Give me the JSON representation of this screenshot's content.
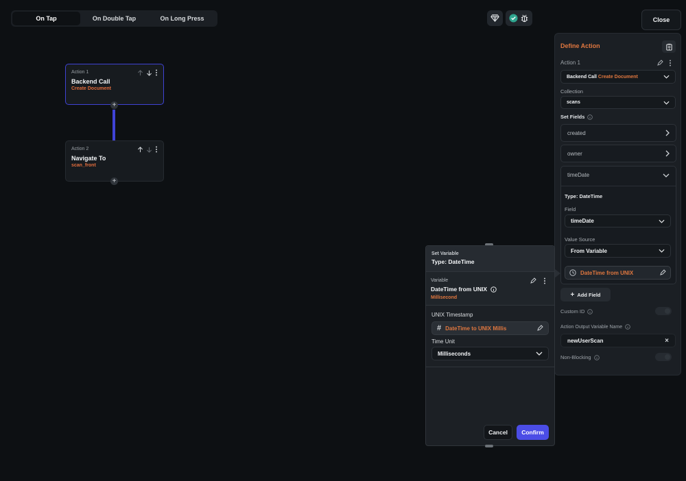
{
  "trigger_tabs": [
    "On Tap",
    "On Double Tap",
    "On Long Press"
  ],
  "header": {
    "close_label": "Close"
  },
  "actions": [
    {
      "num": "Action 1",
      "title": "Backend Call",
      "sub": "Create Document"
    },
    {
      "num": "Action 2",
      "title": "Navigate To",
      "sub": "scan_front"
    }
  ],
  "define_action": {
    "title": "Define Action",
    "action_label": "Action 1",
    "action_type": "Backend Call",
    "action_subtype": "Create Document",
    "collection_label": "Collection",
    "collection_value": "scans",
    "set_fields_label": "Set Fields",
    "fields": [
      "created",
      "owner",
      "timeDate"
    ],
    "type_label": "Type: DateTime",
    "field_label": "Field",
    "field_value": "timeDate",
    "value_source_label": "Value Source",
    "value_source": "From Variable",
    "variable_chip": "DateTime from UNIX",
    "add_field": "Add Field",
    "custom_id_label": "Custom ID",
    "output_var_label": "Action Output Variable Name",
    "output_var_value": "newUserScan",
    "non_blocking_label": "Non-Blocking"
  },
  "set_variable": {
    "header_small": "Set Variable",
    "header_type": "Type: DateTime",
    "variable_label": "Variable",
    "variable_name": "DateTime from UNIX",
    "variable_sub": "Millisecond",
    "unix_label": "UNIX Timestamp",
    "unix_value": "DateTime to UNIX Millis",
    "time_unit_label": "Time Unit",
    "time_unit_value": "Milliseconds",
    "cancel": "Cancel",
    "confirm": "Confirm"
  },
  "colors": {
    "accent": "#4b4de6",
    "orange": "#e0773f",
    "connector": "#3f43d6"
  }
}
